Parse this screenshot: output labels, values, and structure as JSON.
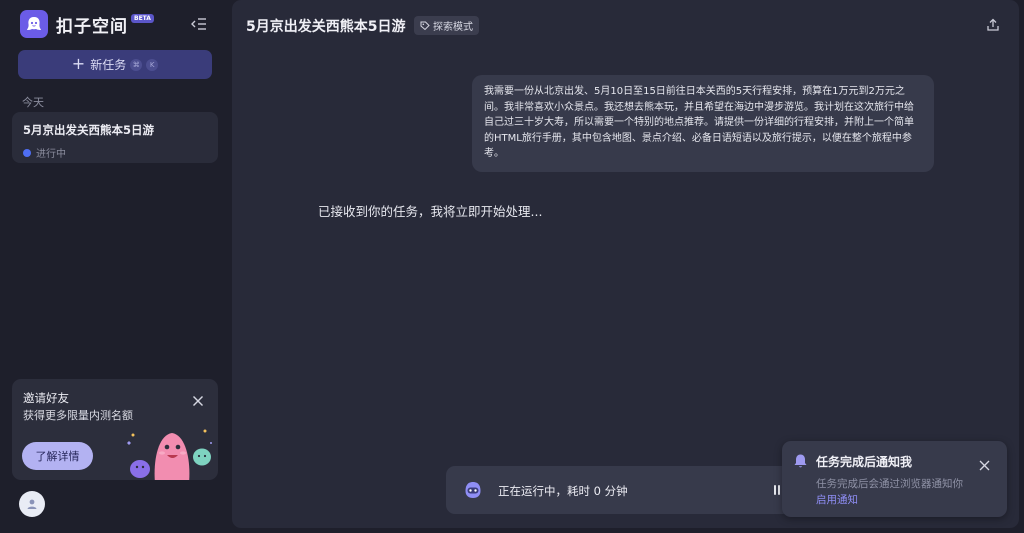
{
  "app": {
    "logo_text": "扣子空间",
    "beta_label": "BETA"
  },
  "sidebar": {
    "new_task_label": "新任务",
    "shortcut_keys": [
      "⌘",
      "K"
    ],
    "section_today": "今天",
    "tasks": [
      {
        "title": "5月京出发关西熊本5日游",
        "status": "进行中",
        "status_color": "#4f6ef2"
      }
    ],
    "invite": {
      "title": "邀请好友",
      "subtitle": "获得更多限量内测名额",
      "button_label": "了解详情"
    }
  },
  "main": {
    "title": "5月京出发关西熊本5日游",
    "mode_badge": "探索模式",
    "user_message": "我需要一份从北京出发、5月10日至15日前往日本关西的5天行程安排，预算在1万元到2万元之间。我非常喜欢小众景点。我还想去熊本玩，并且希望在海边中漫步游览。我计划在这次旅行中给自己过三十岁大寿，所以需要一个特别的地点推荐。请提供一份详细的行程安排，并附上一个简单的HTML旅行手册，其中包含地图、景点介绍、必备日语短语以及旅行提示，以便在整个旅程中参考。",
    "assistant_message": "已接收到你的任务，我将立即开始处理...",
    "status_text": "正在运行中，耗时 0 分钟"
  },
  "notification": {
    "title": "任务完成后通知我",
    "subtitle": "任务完成后会通过浏览器通知你",
    "link_label": "启用通知"
  },
  "colors": {
    "accent": "#6b5ce7",
    "link": "#8f8ef5",
    "background": "#1e1f2b",
    "panel": "#282a39"
  }
}
